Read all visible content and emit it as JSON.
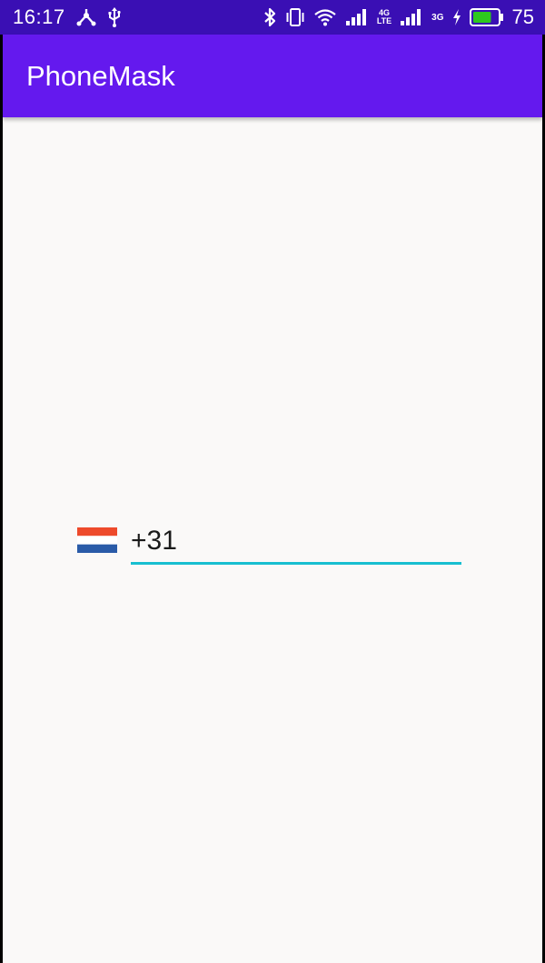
{
  "status_bar": {
    "time": "16:17",
    "left_icons": [
      "network-share-icon",
      "usb-icon"
    ],
    "right_icons": [
      "bluetooth-icon",
      "vibrate-icon",
      "wifi-icon",
      "signal-icon",
      "signal-icon",
      "charging-icon",
      "battery-icon"
    ],
    "net1_top": "4G",
    "net1_bottom": "LTE",
    "net2": "3G",
    "battery_percent": "75",
    "battery_level": 0.75,
    "battery_color": "#2ec81e"
  },
  "app_bar": {
    "title": "PhoneMask",
    "color": "#6419ee"
  },
  "phone_input": {
    "value": "+31",
    "underline_color": "#17bfd0",
    "country_flag": "netherlands-flag-icon"
  }
}
